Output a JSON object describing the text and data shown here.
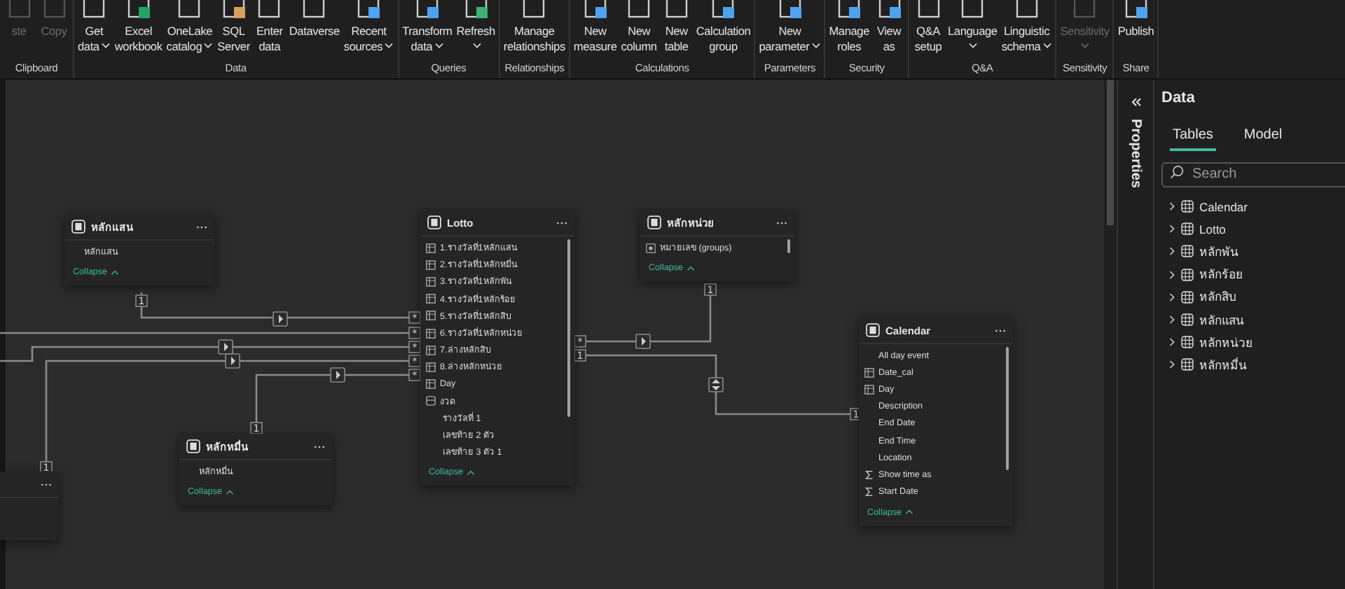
{
  "ribbon": {
    "groups": [
      {
        "label": "Clipboard",
        "buttons": [
          {
            "lines": [
              "ste"
            ],
            "dropdown": false,
            "disabled": true
          },
          {
            "lines": [
              "Copy"
            ],
            "dropdown": false,
            "disabled": true
          }
        ]
      },
      {
        "label": "Data",
        "buttons": [
          {
            "lines": [
              "Get",
              "data"
            ],
            "dropdown": true,
            "disabled": false
          },
          {
            "lines": [
              "Excel",
              "workbook"
            ],
            "dropdown": false,
            "disabled": false
          },
          {
            "lines": [
              "OneLake",
              "catalog"
            ],
            "dropdown": true,
            "disabled": false
          },
          {
            "lines": [
              "SQL",
              "Server"
            ],
            "dropdown": false,
            "disabled": false
          },
          {
            "lines": [
              "Enter",
              "data"
            ],
            "dropdown": false,
            "disabled": false
          },
          {
            "lines": [
              "Dataverse"
            ],
            "dropdown": false,
            "disabled": false
          },
          {
            "lines": [
              "Recent",
              "sources"
            ],
            "dropdown": true,
            "disabled": false
          }
        ]
      },
      {
        "label": "Queries",
        "buttons": [
          {
            "lines": [
              "Transform",
              "data"
            ],
            "dropdown": true,
            "disabled": false
          },
          {
            "lines": [
              "Refresh"
            ],
            "dropdown": true,
            "disabled": false
          }
        ]
      },
      {
        "label": "Relationships",
        "buttons": [
          {
            "lines": [
              "Manage",
              "relationships"
            ],
            "dropdown": false,
            "disabled": false
          }
        ]
      },
      {
        "label": "Calculations",
        "buttons": [
          {
            "lines": [
              "New",
              "measure"
            ],
            "dropdown": false,
            "disabled": false
          },
          {
            "lines": [
              "New",
              "column"
            ],
            "dropdown": false,
            "disabled": false
          },
          {
            "lines": [
              "New",
              "table"
            ],
            "dropdown": false,
            "disabled": false
          },
          {
            "lines": [
              "Calculation",
              "group"
            ],
            "dropdown": false,
            "disabled": false
          }
        ]
      },
      {
        "label": "Parameters",
        "buttons": [
          {
            "lines": [
              "New",
              "parameter"
            ],
            "dropdown": true,
            "disabled": false
          }
        ]
      },
      {
        "label": "Security",
        "buttons": [
          {
            "lines": [
              "Manage",
              "roles"
            ],
            "dropdown": false,
            "disabled": false
          },
          {
            "lines": [
              "View",
              "as"
            ],
            "dropdown": false,
            "disabled": false
          }
        ]
      },
      {
        "label": "Q&A",
        "buttons": [
          {
            "lines": [
              "Q&A",
              "setup"
            ],
            "dropdown": false,
            "disabled": false
          },
          {
            "lines": [
              "Language"
            ],
            "dropdown": true,
            "disabled": false
          },
          {
            "lines": [
              "Linguistic",
              "schema"
            ],
            "dropdown": true,
            "disabled": false
          }
        ]
      },
      {
        "label": "Sensitivity",
        "buttons": [
          {
            "lines": [
              "Sensitivity"
            ],
            "dropdown": true,
            "disabled": true
          }
        ]
      },
      {
        "label": "Share",
        "buttons": [
          {
            "lines": [
              "Publish"
            ],
            "dropdown": false,
            "disabled": false
          }
        ]
      }
    ]
  },
  "canvas": {
    "tables": [
      {
        "title": "หลักแสน",
        "fields": [
          {
            "name": "หลักแสน",
            "kind": "column"
          }
        ],
        "collapse": "Collapse",
        "scrollable": false
      },
      {
        "title": "Lotto",
        "fields": [
          {
            "name": "1.รางวัลที่1หลักแสน",
            "kind": "calculated"
          },
          {
            "name": "2.รางวัลที่1หลักหมื่น",
            "kind": "calculated"
          },
          {
            "name": "3.รางวัลที่1หลักพัน",
            "kind": "calculated"
          },
          {
            "name": "4.รางวัลที่1หลักร้อย",
            "kind": "calculated"
          },
          {
            "name": "5.รางวัลที่1หลักสิบ",
            "kind": "calculated"
          },
          {
            "name": "6.รางวัลที่1หลักหน่วย",
            "kind": "calculated"
          },
          {
            "name": "7.ล่างหลักสิบ",
            "kind": "calculated"
          },
          {
            "name": "8.ล่างหลักหน่วย",
            "kind": "calculated"
          },
          {
            "name": "Day",
            "kind": "calculated"
          },
          {
            "name": "งวด",
            "kind": "hierarchy"
          },
          {
            "name": "รางวัลที่ 1",
            "kind": "level"
          },
          {
            "name": "เลขท้าย 2 ตัว",
            "kind": "level"
          },
          {
            "name": "เลขท้าย 3 ตัว 1",
            "kind": "level"
          }
        ],
        "collapse": "Collapse",
        "scrollable": true
      },
      {
        "title": "หลักหน่วย",
        "fields": [
          {
            "name": "หมายเลข (groups)",
            "kind": "group"
          }
        ],
        "collapse": "Collapse",
        "scrollable": true
      },
      {
        "title": "Calendar",
        "fields": [
          {
            "name": "All day event",
            "kind": "column"
          },
          {
            "name": "Date_cal",
            "kind": "calculated"
          },
          {
            "name": "Day",
            "kind": "calculated"
          },
          {
            "name": "Description",
            "kind": "column"
          },
          {
            "name": "End Date",
            "kind": "column"
          },
          {
            "name": "End Time",
            "kind": "column"
          },
          {
            "name": "Location",
            "kind": "column"
          },
          {
            "name": "Show time as",
            "kind": "sum"
          },
          {
            "name": "Start Date",
            "kind": "sum"
          }
        ],
        "collapse": "Collapse",
        "scrollable": true
      },
      {
        "title": "หลักหมื่น",
        "fields": [
          {
            "name": "หลักหมื่น",
            "kind": "column"
          }
        ],
        "collapse": "Collapse",
        "scrollable": false
      }
    ],
    "relationships": [
      {
        "one": "1",
        "many": "*",
        "kind": "single"
      },
      {
        "many": "*",
        "kind": "plain"
      },
      {
        "many": "*",
        "kind": "single"
      },
      {
        "one": "1",
        "many": "*",
        "kind": "single"
      },
      {
        "one": "1",
        "many": "*",
        "kind": "single"
      },
      {
        "one": "1",
        "many": "*",
        "kind": "single"
      },
      {
        "one": "1",
        "many": "1",
        "kind": "both"
      }
    ]
  },
  "properties_pane": {
    "title": "Properties"
  },
  "data_pane": {
    "title": "Data",
    "tabs": [
      {
        "label": "Tables",
        "selected": true
      },
      {
        "label": "Model",
        "selected": false
      }
    ],
    "search": {
      "placeholder": "Search"
    },
    "tables": [
      {
        "name": "Calendar",
        "expanded": false
      },
      {
        "name": "Lotto",
        "expanded": false
      },
      {
        "name": "หลักพัน",
        "expanded": false
      },
      {
        "name": "หลักร้อย",
        "expanded": false
      },
      {
        "name": "หลักสิบ",
        "expanded": false
      },
      {
        "name": "หลักแสน",
        "expanded": false
      },
      {
        "name": "หลักหน่วย",
        "expanded": false
      },
      {
        "name": "หลักหมื่น",
        "expanded": false
      }
    ]
  }
}
